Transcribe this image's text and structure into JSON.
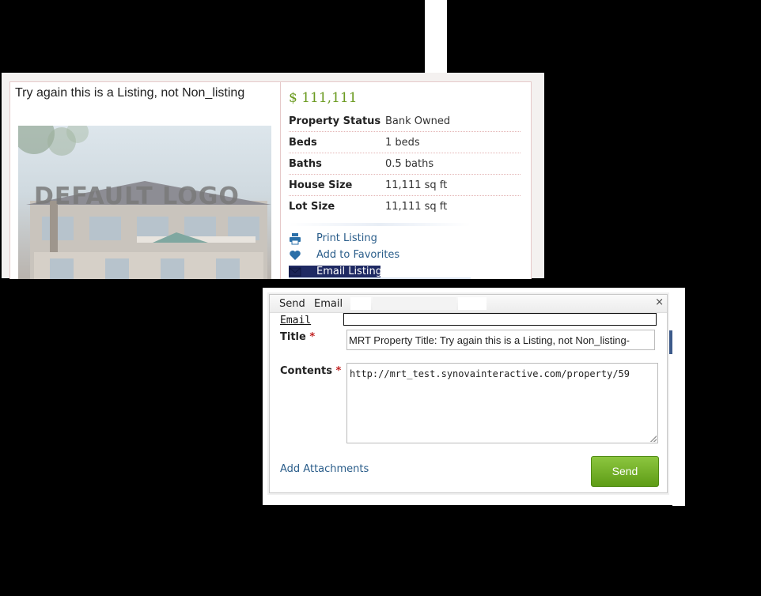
{
  "listing": {
    "title": "Try again this is a Listing, not Non_listing",
    "photo_text": "DEFAULT LOGO",
    "price": "$ 111,111",
    "details": [
      {
        "label": "Property Status",
        "value": "Bank Owned"
      },
      {
        "label": "Beds",
        "value": "1 beds"
      },
      {
        "label": "Baths",
        "value": "0.5 baths"
      },
      {
        "label": "House Size",
        "value": "11,111 sq ft"
      },
      {
        "label": "Lot Size",
        "value": "11,111 sq ft"
      }
    ],
    "actions": {
      "print": "Print Listing",
      "favorites": "Add to Favorites",
      "email": "Email Listing"
    },
    "colors": {
      "price": "#6a9a1f",
      "link": "#2a5d8a",
      "selected": "#1f2a63"
    }
  },
  "dialog": {
    "title_part1": "Send",
    "title_part2": "Email",
    "close": "×",
    "email_label": "Email",
    "title_label": "Title",
    "title_required": "*",
    "title_value": "MRT Property Title: Try again this is a Listing, not Non_listing-",
    "contents_label": "Contents",
    "contents_required": "*",
    "contents_value": "http://mrt_test.synovainteractive.com/property/59",
    "add_attachments": "Add Attachments",
    "send": "Send",
    "send_color": "#6fae22"
  }
}
